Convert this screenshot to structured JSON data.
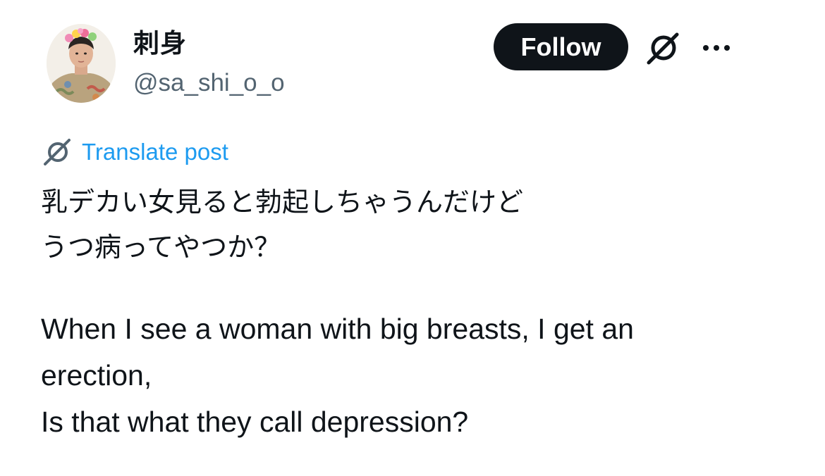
{
  "post": {
    "author": {
      "display_name": "刺身",
      "handle": "@sa_shi_o_o",
      "avatar_icon": "profile-avatar"
    },
    "actions": {
      "follow_label": "Follow",
      "grok_icon": "grok-icon",
      "more_icon": "more-dots-icon"
    },
    "translate": {
      "label": "Translate post",
      "icon": "grok-translate-icon",
      "color": "#1d9bf0"
    },
    "text_original": [
      "乳デカい女見ると勃起しちゃうんだけど",
      "うつ病ってやつか？"
    ],
    "text_translated": [
      "When I see a woman with big breasts, I get an",
      "erection,",
      "Is that what they call depression?"
    ]
  }
}
